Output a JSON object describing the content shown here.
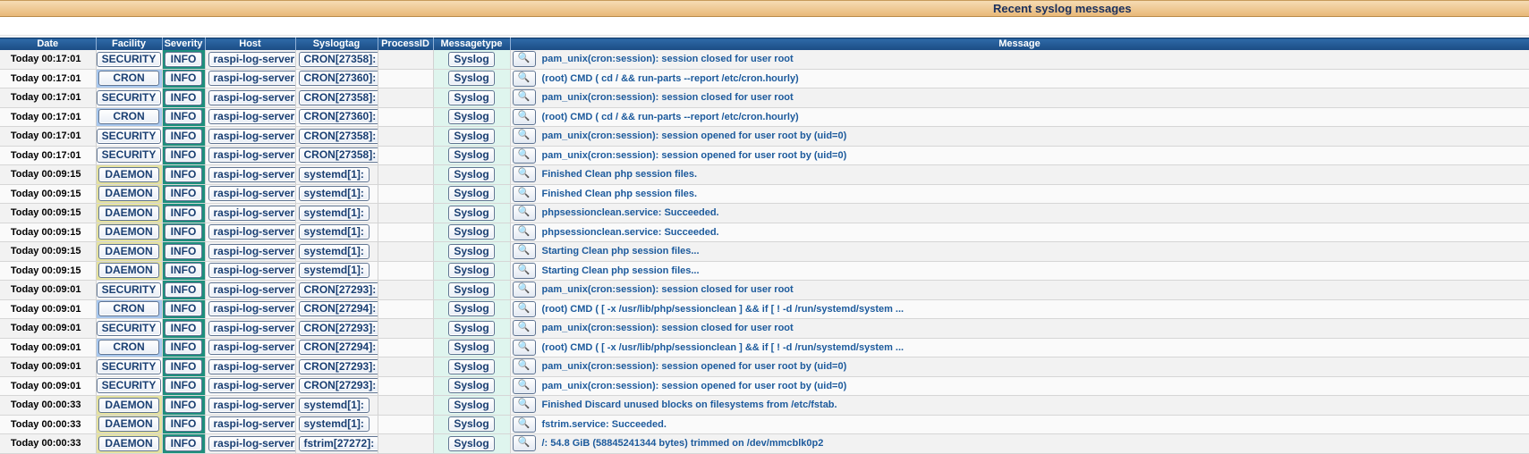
{
  "page": {
    "title": "Recent syslog messages"
  },
  "columns": [
    "Date",
    "Facility",
    "Severity",
    "Host",
    "Syslogtag",
    "ProcessID",
    "Messagetype",
    "Message"
  ],
  "rows": [
    {
      "date": "Today 00:17:01",
      "facility": "SECURITY",
      "severity": "INFO",
      "host": "raspi-log-server",
      "tag": "CRON[27358]:",
      "pid": "",
      "type": "Syslog",
      "message": "pam_unix(cron:session): session closed for user root"
    },
    {
      "date": "Today 00:17:01",
      "facility": "CRON",
      "severity": "INFO",
      "host": "raspi-log-server",
      "tag": "CRON[27360]:",
      "pid": "",
      "type": "Syslog",
      "message": "(root) CMD ( cd / && run-parts --report /etc/cron.hourly)"
    },
    {
      "date": "Today 00:17:01",
      "facility": "SECURITY",
      "severity": "INFO",
      "host": "raspi-log-server",
      "tag": "CRON[27358]:",
      "pid": "",
      "type": "Syslog",
      "message": "pam_unix(cron:session): session closed for user root"
    },
    {
      "date": "Today 00:17:01",
      "facility": "CRON",
      "severity": "INFO",
      "host": "raspi-log-server",
      "tag": "CRON[27360]:",
      "pid": "",
      "type": "Syslog",
      "message": "(root) CMD ( cd / && run-parts --report /etc/cron.hourly)"
    },
    {
      "date": "Today 00:17:01",
      "facility": "SECURITY",
      "severity": "INFO",
      "host": "raspi-log-server",
      "tag": "CRON[27358]:",
      "pid": "",
      "type": "Syslog",
      "message": "pam_unix(cron:session): session opened for user root by (uid=0)"
    },
    {
      "date": "Today 00:17:01",
      "facility": "SECURITY",
      "severity": "INFO",
      "host": "raspi-log-server",
      "tag": "CRON[27358]:",
      "pid": "",
      "type": "Syslog",
      "message": "pam_unix(cron:session): session opened for user root by (uid=0)"
    },
    {
      "date": "Today 00:09:15",
      "facility": "DAEMON",
      "severity": "INFO",
      "host": "raspi-log-server",
      "tag": "systemd[1]:",
      "pid": "",
      "type": "Syslog",
      "message": "Finished Clean php session files."
    },
    {
      "date": "Today 00:09:15",
      "facility": "DAEMON",
      "severity": "INFO",
      "host": "raspi-log-server",
      "tag": "systemd[1]:",
      "pid": "",
      "type": "Syslog",
      "message": "Finished Clean php session files."
    },
    {
      "date": "Today 00:09:15",
      "facility": "DAEMON",
      "severity": "INFO",
      "host": "raspi-log-server",
      "tag": "systemd[1]:",
      "pid": "",
      "type": "Syslog",
      "message": "phpsessionclean.service: Succeeded."
    },
    {
      "date": "Today 00:09:15",
      "facility": "DAEMON",
      "severity": "INFO",
      "host": "raspi-log-server",
      "tag": "systemd[1]:",
      "pid": "",
      "type": "Syslog",
      "message": "phpsessionclean.service: Succeeded."
    },
    {
      "date": "Today 00:09:15",
      "facility": "DAEMON",
      "severity": "INFO",
      "host": "raspi-log-server",
      "tag": "systemd[1]:",
      "pid": "",
      "type": "Syslog",
      "message": "Starting Clean php session files..."
    },
    {
      "date": "Today 00:09:15",
      "facility": "DAEMON",
      "severity": "INFO",
      "host": "raspi-log-server",
      "tag": "systemd[1]:",
      "pid": "",
      "type": "Syslog",
      "message": "Starting Clean php session files..."
    },
    {
      "date": "Today 00:09:01",
      "facility": "SECURITY",
      "severity": "INFO",
      "host": "raspi-log-server",
      "tag": "CRON[27293]:",
      "pid": "",
      "type": "Syslog",
      "message": "pam_unix(cron:session): session closed for user root"
    },
    {
      "date": "Today 00:09:01",
      "facility": "CRON",
      "severity": "INFO",
      "host": "raspi-log-server",
      "tag": "CRON[27294]:",
      "pid": "",
      "type": "Syslog",
      "message": "(root) CMD ( [ -x /usr/lib/php/sessionclean ] && if [ ! -d /run/systemd/system ..."
    },
    {
      "date": "Today 00:09:01",
      "facility": "SECURITY",
      "severity": "INFO",
      "host": "raspi-log-server",
      "tag": "CRON[27293]:",
      "pid": "",
      "type": "Syslog",
      "message": "pam_unix(cron:session): session closed for user root"
    },
    {
      "date": "Today 00:09:01",
      "facility": "CRON",
      "severity": "INFO",
      "host": "raspi-log-server",
      "tag": "CRON[27294]:",
      "pid": "",
      "type": "Syslog",
      "message": "(root) CMD ( [ -x /usr/lib/php/sessionclean ] && if [ ! -d /run/systemd/system ..."
    },
    {
      "date": "Today 00:09:01",
      "facility": "SECURITY",
      "severity": "INFO",
      "host": "raspi-log-server",
      "tag": "CRON[27293]:",
      "pid": "",
      "type": "Syslog",
      "message": "pam_unix(cron:session): session opened for user root by (uid=0)"
    },
    {
      "date": "Today 00:09:01",
      "facility": "SECURITY",
      "severity": "INFO",
      "host": "raspi-log-server",
      "tag": "CRON[27293]:",
      "pid": "",
      "type": "Syslog",
      "message": "pam_unix(cron:session): session opened for user root by (uid=0)"
    },
    {
      "date": "Today 00:00:33",
      "facility": "DAEMON",
      "severity": "INFO",
      "host": "raspi-log-server",
      "tag": "systemd[1]:",
      "pid": "",
      "type": "Syslog",
      "message": "Finished Discard unused blocks on filesystems from /etc/fstab."
    },
    {
      "date": "Today 00:00:33",
      "facility": "DAEMON",
      "severity": "INFO",
      "host": "raspi-log-server",
      "tag": "systemd[1]:",
      "pid": "",
      "type": "Syslog",
      "message": "fstrim.service: Succeeded."
    },
    {
      "date": "Today 00:00:33",
      "facility": "DAEMON",
      "severity": "INFO",
      "host": "raspi-log-server",
      "tag": "fstrim[27272]:",
      "pid": "",
      "type": "Syslog",
      "message": "/: 54.8 GiB (58845241344 bytes) trimmed on /dev/mmcblk0p2"
    }
  ],
  "icons": {
    "details_button": "magnifier-details-icon"
  },
  "colors": {
    "header_bg": "#1b4c84",
    "severity_bg": "#1d8f7c",
    "facility_cron_bg": "#a9c8ee",
    "facility_daemon_bg": "#e5e2a0",
    "messagetype_bg": "#dff5ee",
    "message_text": "#1c5a9c"
  }
}
